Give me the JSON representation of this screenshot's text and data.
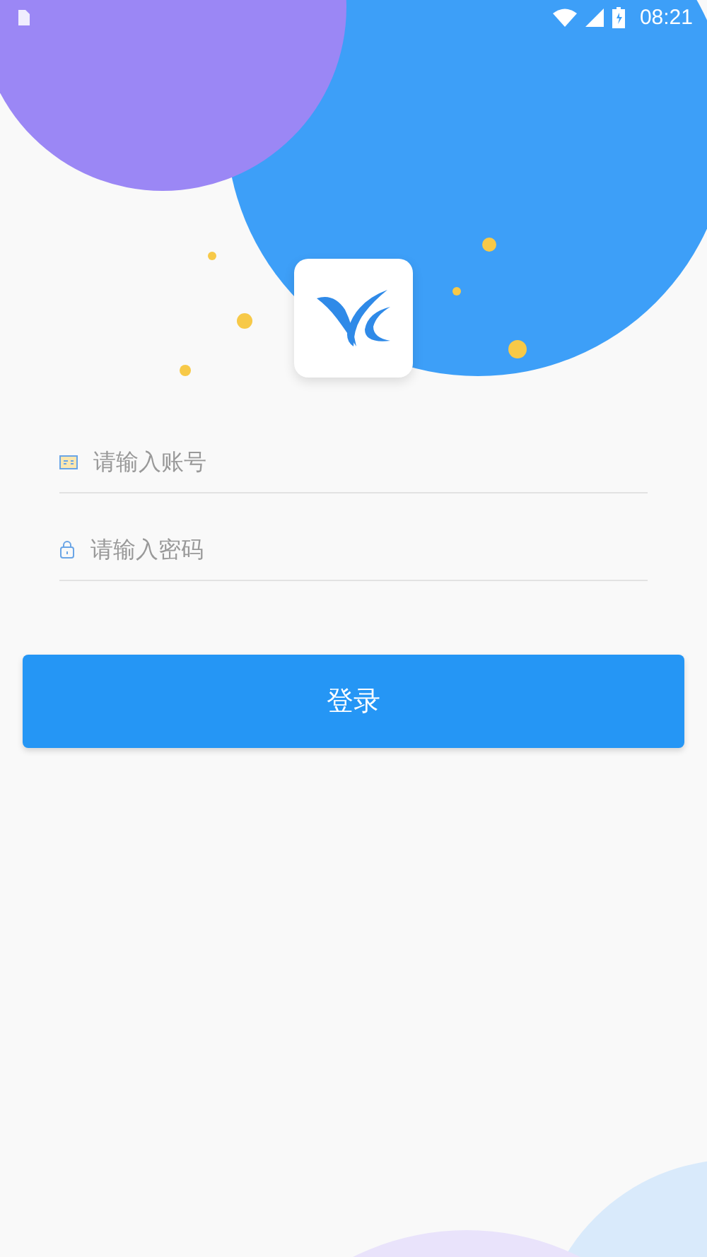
{
  "status_bar": {
    "time": "08:21"
  },
  "fields": [
    {
      "kind": "account",
      "placeholder": "请输入账号"
    },
    {
      "kind": "password",
      "placeholder": "请输入密码"
    }
  ],
  "login_button": {
    "label": "登录"
  }
}
